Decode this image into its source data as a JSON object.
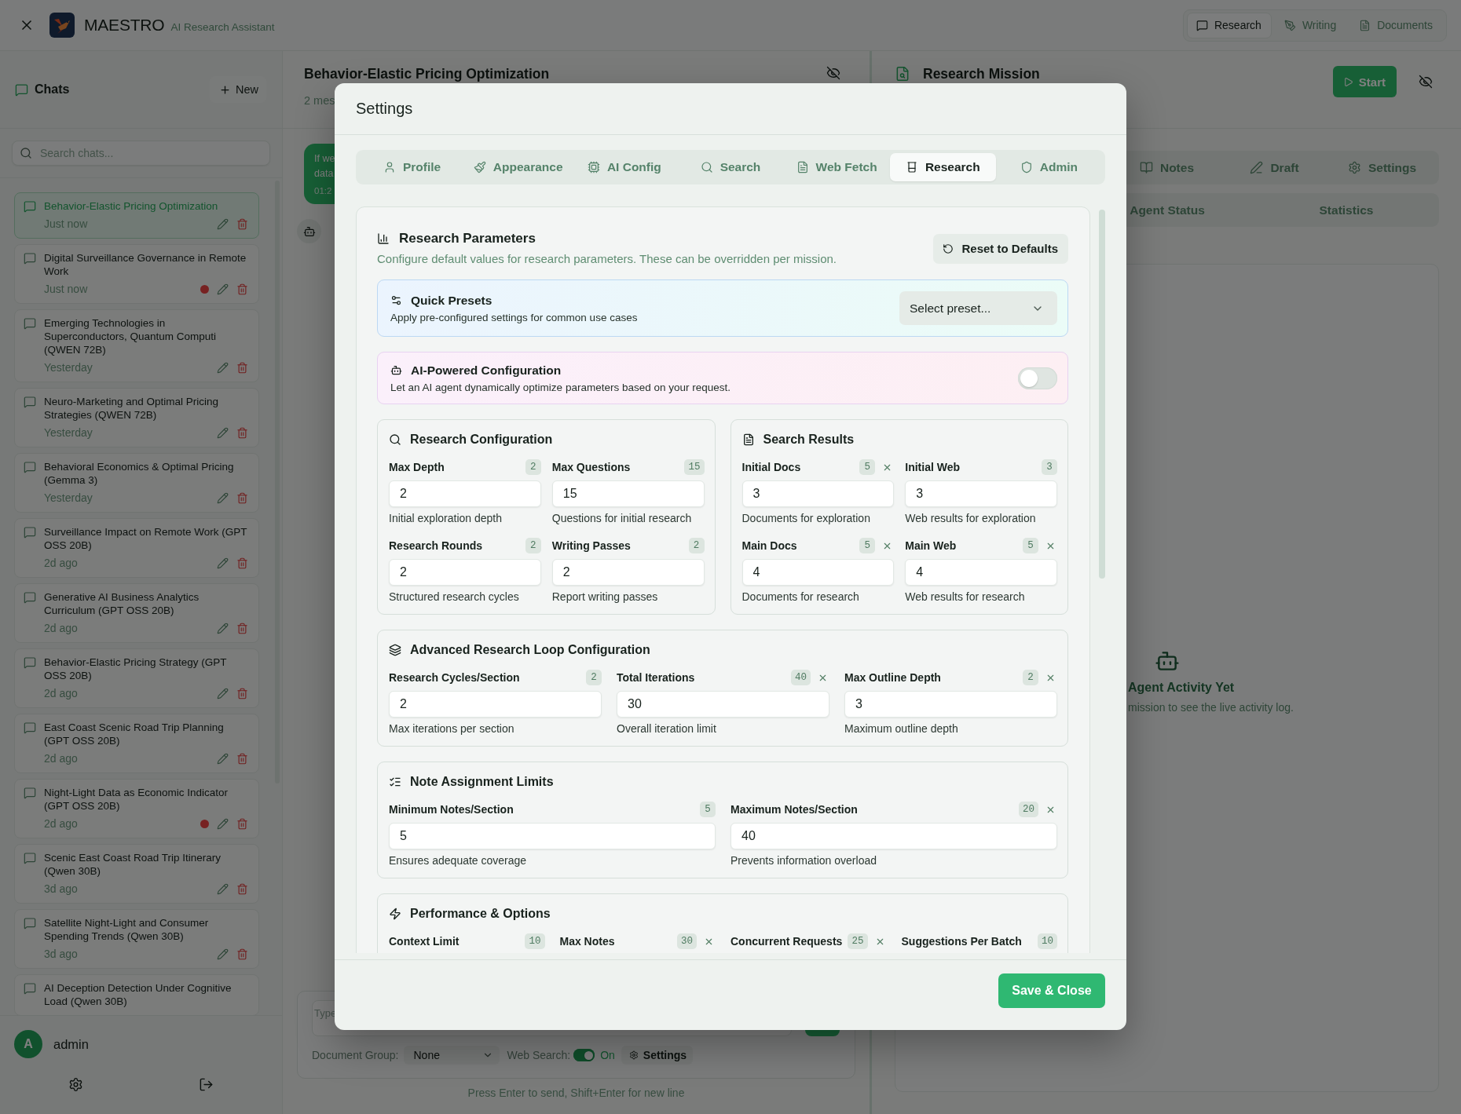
{
  "app_header": {
    "title": "MAESTRO",
    "subtitle": "AI Research Assistant",
    "nav": [
      {
        "label": "Research",
        "selected": true
      },
      {
        "label": "Writing",
        "selected": false
      },
      {
        "label": "Documents",
        "selected": false
      }
    ]
  },
  "sidebar": {
    "title": "Chats",
    "new_button": "New",
    "search": {
      "placeholder": "Search chats..."
    },
    "chats": [
      {
        "title": "Behavior-Elastic Pricing Optimization",
        "time": "Just now",
        "selected": true,
        "indicator": false
      },
      {
        "title": "Digital Surveillance Governance in Remote Work",
        "time": "Just now",
        "selected": false,
        "indicator": true
      },
      {
        "title": "Emerging Technologies in Superconductors, Quantum Computi (QWEN 72B)",
        "time": "Yesterday",
        "selected": false,
        "indicator": false
      },
      {
        "title": "Neuro-Marketing and Optimal Pricing Strategies (QWEN 72B)",
        "time": "Yesterday",
        "selected": false,
        "indicator": false
      },
      {
        "title": "Behavioral Economics & Optimal Pricing (Gemma 3)",
        "time": "Yesterday",
        "selected": false,
        "indicator": false
      },
      {
        "title": "Surveillance Impact on Remote Work (GPT OSS 20B)",
        "time": "2d ago",
        "selected": false,
        "indicator": false
      },
      {
        "title": "Generative AI Business Analytics Curriculum (GPT OSS 20B)",
        "time": "2d ago",
        "selected": false,
        "indicator": false
      },
      {
        "title": "Behavior-Elastic Pricing Strategy (GPT OSS 20B)",
        "time": "2d ago",
        "selected": false,
        "indicator": false
      },
      {
        "title": "East Coast Scenic Road Trip Planning (GPT OSS 20B)",
        "time": "2d ago",
        "selected": false,
        "indicator": false
      },
      {
        "title": "Night-Light Data as Economic Indicator (GPT OSS 20B)",
        "time": "2d ago",
        "selected": false,
        "indicator": true
      },
      {
        "title": "Scenic East Coast Road Trip Itinerary (Qwen 30B)",
        "time": "3d ago",
        "selected": false,
        "indicator": false
      },
      {
        "title": "Satellite Night-Light and Consumer Spending Trends (Qwen 30B)",
        "time": "3d ago",
        "selected": false,
        "indicator": false
      },
      {
        "title": "AI Deception Detection Under Cognitive Load (Qwen 30B)",
        "selected": false
      }
    ],
    "user": {
      "initial": "A",
      "name": "admin"
    }
  },
  "chat_panel": {
    "title": "Behavior-Elastic Pricing Optimization",
    "subtitle": "2 mes",
    "message": {
      "lines": [
        "If we",
        "data"
      ],
      "time": "01:2"
    },
    "composer": {
      "placeholder": "Type",
      "document_group": {
        "label": "Document Group:",
        "value": "None"
      },
      "web_search": {
        "label": "Web Search:",
        "on": true,
        "state": "On"
      },
      "settings_button": "Settings"
    },
    "hint": "Press Enter to send, Shift+Enter for new line"
  },
  "mission_panel": {
    "title": "Research Mission",
    "start_button": "Start",
    "tabs": [
      {
        "label": "Notes",
        "selected": false
      },
      {
        "label": "Draft",
        "selected": false
      },
      {
        "label": "Settings",
        "selected": false
      }
    ],
    "subtabs": [
      {
        "label": "Agent Status",
        "selected": false
      },
      {
        "label": "Statistics",
        "selected": false
      }
    ],
    "empty_state": {
      "title": "Agent Activity Yet",
      "text": "mission to see the live activity log."
    }
  },
  "settings_dialog": {
    "title": "Settings",
    "tabs": [
      {
        "label": "Profile",
        "selected": false
      },
      {
        "label": "Appearance",
        "selected": false
      },
      {
        "label": "AI Config",
        "selected": false
      },
      {
        "label": "Search",
        "selected": false
      },
      {
        "label": "Web Fetch",
        "selected": false
      },
      {
        "label": "Research",
        "selected": true
      },
      {
        "label": "Admin",
        "selected": false
      }
    ],
    "research": {
      "title": "Research Parameters",
      "description": "Configure default values for research parameters. These can be overridden per mission.",
      "reset_button": "Reset to Defaults",
      "presets": {
        "title": "Quick Presets",
        "description": "Apply pre-configured settings for common use cases",
        "placeholder": "Select preset..."
      },
      "ai_config": {
        "title": "AI-Powered Configuration",
        "description": "Let an AI agent dynamically optimize parameters based on your request.",
        "on": false
      },
      "group_rows": [
        [
          {
            "title": "Research Configuration",
            "fields": [
              {
                "label": "Max Depth",
                "default": "2",
                "value": "2",
                "hint": "Initial exploration depth",
                "modified": false
              },
              {
                "label": "Max Questions",
                "default": "15",
                "value": "15",
                "hint": "Questions for initial research",
                "modified": false
              },
              {
                "label": "Research Rounds",
                "default": "2",
                "value": "2",
                "hint": "Structured research cycles",
                "modified": false
              },
              {
                "label": "Writing Passes",
                "default": "2",
                "value": "2",
                "hint": "Report writing passes",
                "modified": false
              }
            ]
          },
          {
            "title": "Search Results",
            "fields": [
              {
                "label": "Initial Docs",
                "default": "5",
                "value": "3",
                "hint": "Documents for exploration",
                "modified": true
              },
              {
                "label": "Initial Web",
                "default": "3",
                "value": "3",
                "hint": "Web results for exploration",
                "modified": false
              },
              {
                "label": "Main Docs",
                "default": "5",
                "value": "4",
                "hint": "Documents for research",
                "modified": true
              },
              {
                "label": "Main Web",
                "default": "5",
                "value": "4",
                "hint": "Web results for research",
                "modified": true
              }
            ]
          }
        ],
        [
          {
            "title": "Advanced Research Loop Configuration",
            "fields": [
              {
                "label": "Research Cycles/Section",
                "default": "2",
                "value": "2",
                "hint": "Max iterations per section",
                "modified": false
              },
              {
                "label": "Total Iterations",
                "default": "40",
                "value": "30",
                "hint": "Overall iteration limit",
                "modified": true
              },
              {
                "label": "Max Outline Depth",
                "default": "2",
                "value": "3",
                "hint": "Maximum outline depth",
                "modified": true
              }
            ]
          }
        ],
        [
          {
            "title": "Note Assignment Limits",
            "fields": [
              {
                "label": "Minimum Notes/Section",
                "default": "5",
                "value": "5",
                "hint": "Ensures adequate coverage",
                "modified": false
              },
              {
                "label": "Maximum Notes/Section",
                "default": "20",
                "value": "40",
                "hint": "Prevents information overload",
                "modified": true
              }
            ]
          }
        ],
        [
          {
            "title": "Performance & Options",
            "fields": [
              {
                "label": "Context Limit",
                "default": "10",
                "modified": false
              },
              {
                "label": "Max Notes",
                "default": "30",
                "modified": true
              },
              {
                "label": "Concurrent Requests",
                "default": "25",
                "modified": true
              },
              {
                "label": "Suggestions Per Batch",
                "default": "10",
                "modified": false
              }
            ]
          }
        ]
      ]
    },
    "save_button": "Save & Close"
  }
}
